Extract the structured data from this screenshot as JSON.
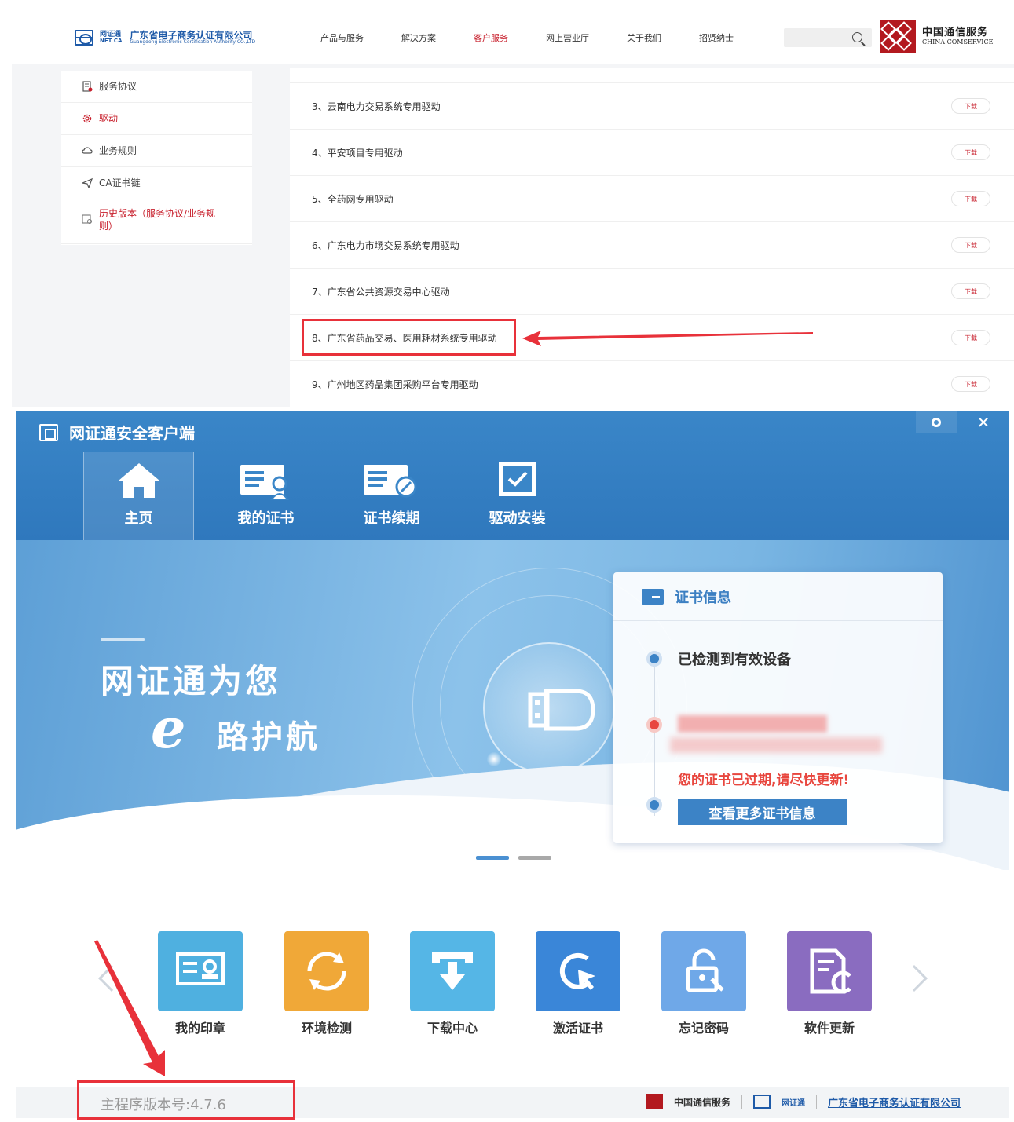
{
  "website": {
    "logo": {
      "brand": "网证通",
      "brand_en": "NET CA",
      "name_cn": "广东省电子商务认证有限公司",
      "name_en": "Guangdong Electronic Certification Authority CO.,LTD"
    },
    "nav": [
      {
        "label": "产品与服务"
      },
      {
        "label": "解决方案"
      },
      {
        "label": "客户服务",
        "active": true
      },
      {
        "label": "网上营业厅"
      },
      {
        "label": "关于我们"
      },
      {
        "label": "招贤纳士"
      }
    ],
    "partner_logo": {
      "name_cn": "中国通信服务",
      "name_en": "CHINA COMSERVICE"
    },
    "sidebar": [
      {
        "label": "服务协议",
        "icon": "document-icon"
      },
      {
        "label": "驱动",
        "icon": "gear-icon",
        "active": true
      },
      {
        "label": "业务规则",
        "icon": "cloud-icon"
      },
      {
        "label": "CA证书链",
        "icon": "send-icon"
      },
      {
        "label": "历史版本（服务协议/业务规则）",
        "icon": "history-doc-icon"
      }
    ],
    "drivers": [
      {
        "label": "3、云南电力交易系统专用驱动",
        "button": "下载"
      },
      {
        "label": "4、平安项目专用驱动",
        "button": "下载"
      },
      {
        "label": "5、全药网专用驱动",
        "button": "下载"
      },
      {
        "label": "6、广东电力市场交易系统专用驱动",
        "button": "下载"
      },
      {
        "label": "7、广东省公共资源交易中心驱动",
        "button": "下载"
      },
      {
        "label": "8、广东省药品交易、医用耗材系统专用驱动",
        "button": "下载",
        "highlighted": true
      },
      {
        "label": "9、广州地区药品集团采购平台专用驱动",
        "button": "下载"
      }
    ]
  },
  "client": {
    "title": "网证通安全客户端",
    "tabs": [
      {
        "label": "主页",
        "icon": "home-icon",
        "active": true
      },
      {
        "label": "我的证书",
        "icon": "certificate-icon"
      },
      {
        "label": "证书续期",
        "icon": "renew-certificate-icon"
      },
      {
        "label": "驱动安装",
        "icon": "driver-install-icon"
      }
    ],
    "banner": {
      "line1": "网证通为您",
      "e": "e",
      "line2": "路护航"
    },
    "cert_card": {
      "title": "证书信息",
      "device_status": "已检测到有效设备",
      "expired_msg": "您的证书已过期,请尽快更新!",
      "more_button": "查看更多证书信息"
    },
    "tiles": [
      {
        "label": "我的印章",
        "color": "#4fb0e0",
        "icon": "seal-icon"
      },
      {
        "label": "环境检测",
        "color": "#f0a838",
        "icon": "refresh-icon"
      },
      {
        "label": "下载中心",
        "color": "#55b6e6",
        "icon": "download-icon"
      },
      {
        "label": "激活证书",
        "color": "#3a86d8",
        "icon": "activate-cursor-icon"
      },
      {
        "label": "忘记密码",
        "color": "#6fa8e8",
        "icon": "unlock-icon"
      },
      {
        "label": "软件更新",
        "color": "#8a6cc0",
        "icon": "software-update-icon"
      }
    ],
    "footer": {
      "version": "主程序版本号:4.7.6",
      "logo_cs": "中国通信服务",
      "logo_netca": "网证通",
      "company": "广东省电子商务认证有限公司"
    }
  },
  "colors": {
    "accent_red": "#c8202d",
    "highlight_red": "#e8313a",
    "client_blue": "#2f78bd"
  }
}
